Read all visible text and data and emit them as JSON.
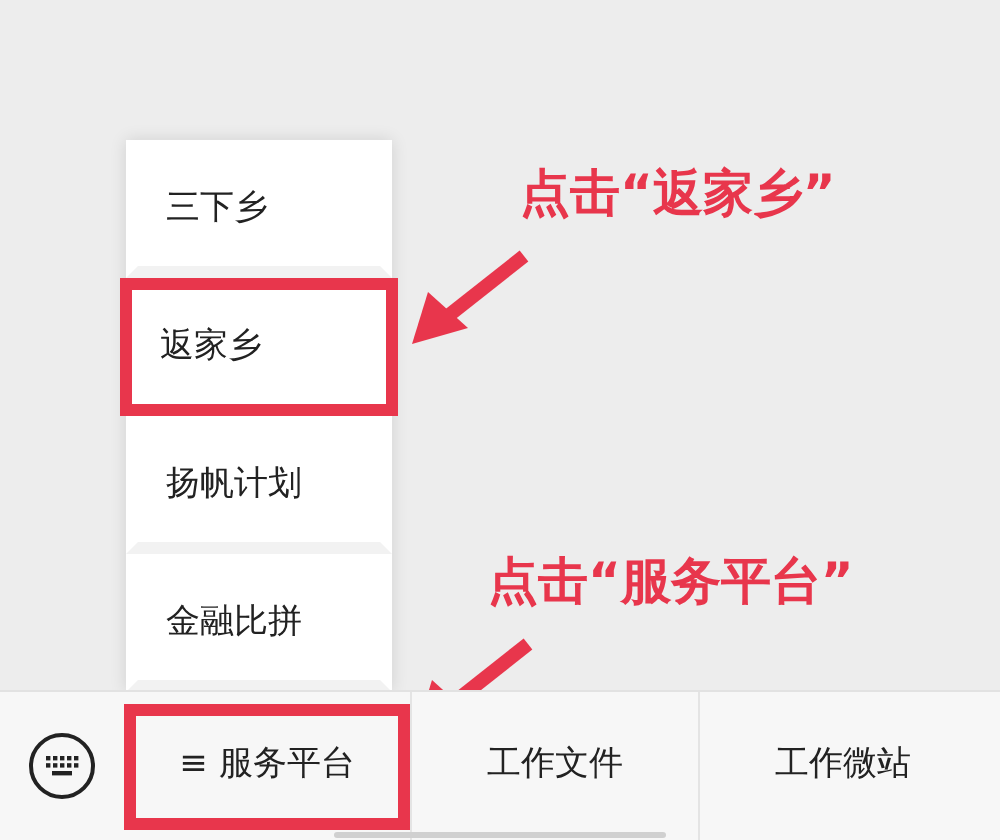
{
  "menu": {
    "items": [
      {
        "label": "三下乡",
        "highlighted": false
      },
      {
        "label": "返家乡",
        "highlighted": true
      },
      {
        "label": "扬帆计划",
        "highlighted": false
      },
      {
        "label": "金融比拼",
        "highlighted": false
      }
    ]
  },
  "bottom_bar": {
    "tabs": [
      {
        "label": "≡ 服务平台",
        "highlighted": true
      },
      {
        "label": "工作文件",
        "highlighted": false
      },
      {
        "label": "工作微站",
        "highlighted": false
      }
    ]
  },
  "annotations": [
    {
      "text": "点击“返家乡”"
    },
    {
      "text": "点击“服务平台”"
    }
  ]
}
